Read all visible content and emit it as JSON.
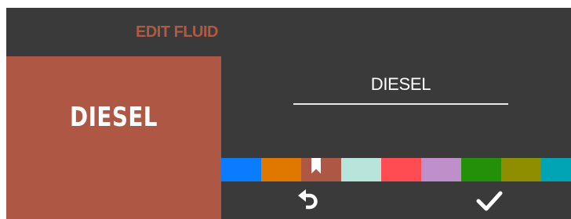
{
  "header": {
    "title": "EDIT FLUID"
  },
  "preview": {
    "label": "DIESEL",
    "color": "#ad5744"
  },
  "name_field": {
    "value": "DIESEL"
  },
  "palette": {
    "selected_index": 2,
    "colors": [
      "#0a7cff",
      "#e07800",
      "#ad5744",
      "#b7e5dc",
      "#ff4b52",
      "#bf8fcc",
      "#249009",
      "#8f8e00",
      "#01a4b5"
    ]
  },
  "actions": {
    "undo_icon": "undo-arrow-icon",
    "confirm_icon": "checkmark-icon"
  },
  "theme": {
    "background": "#3a3a3a",
    "accent": "#b05a44",
    "text": "#ffffff"
  }
}
